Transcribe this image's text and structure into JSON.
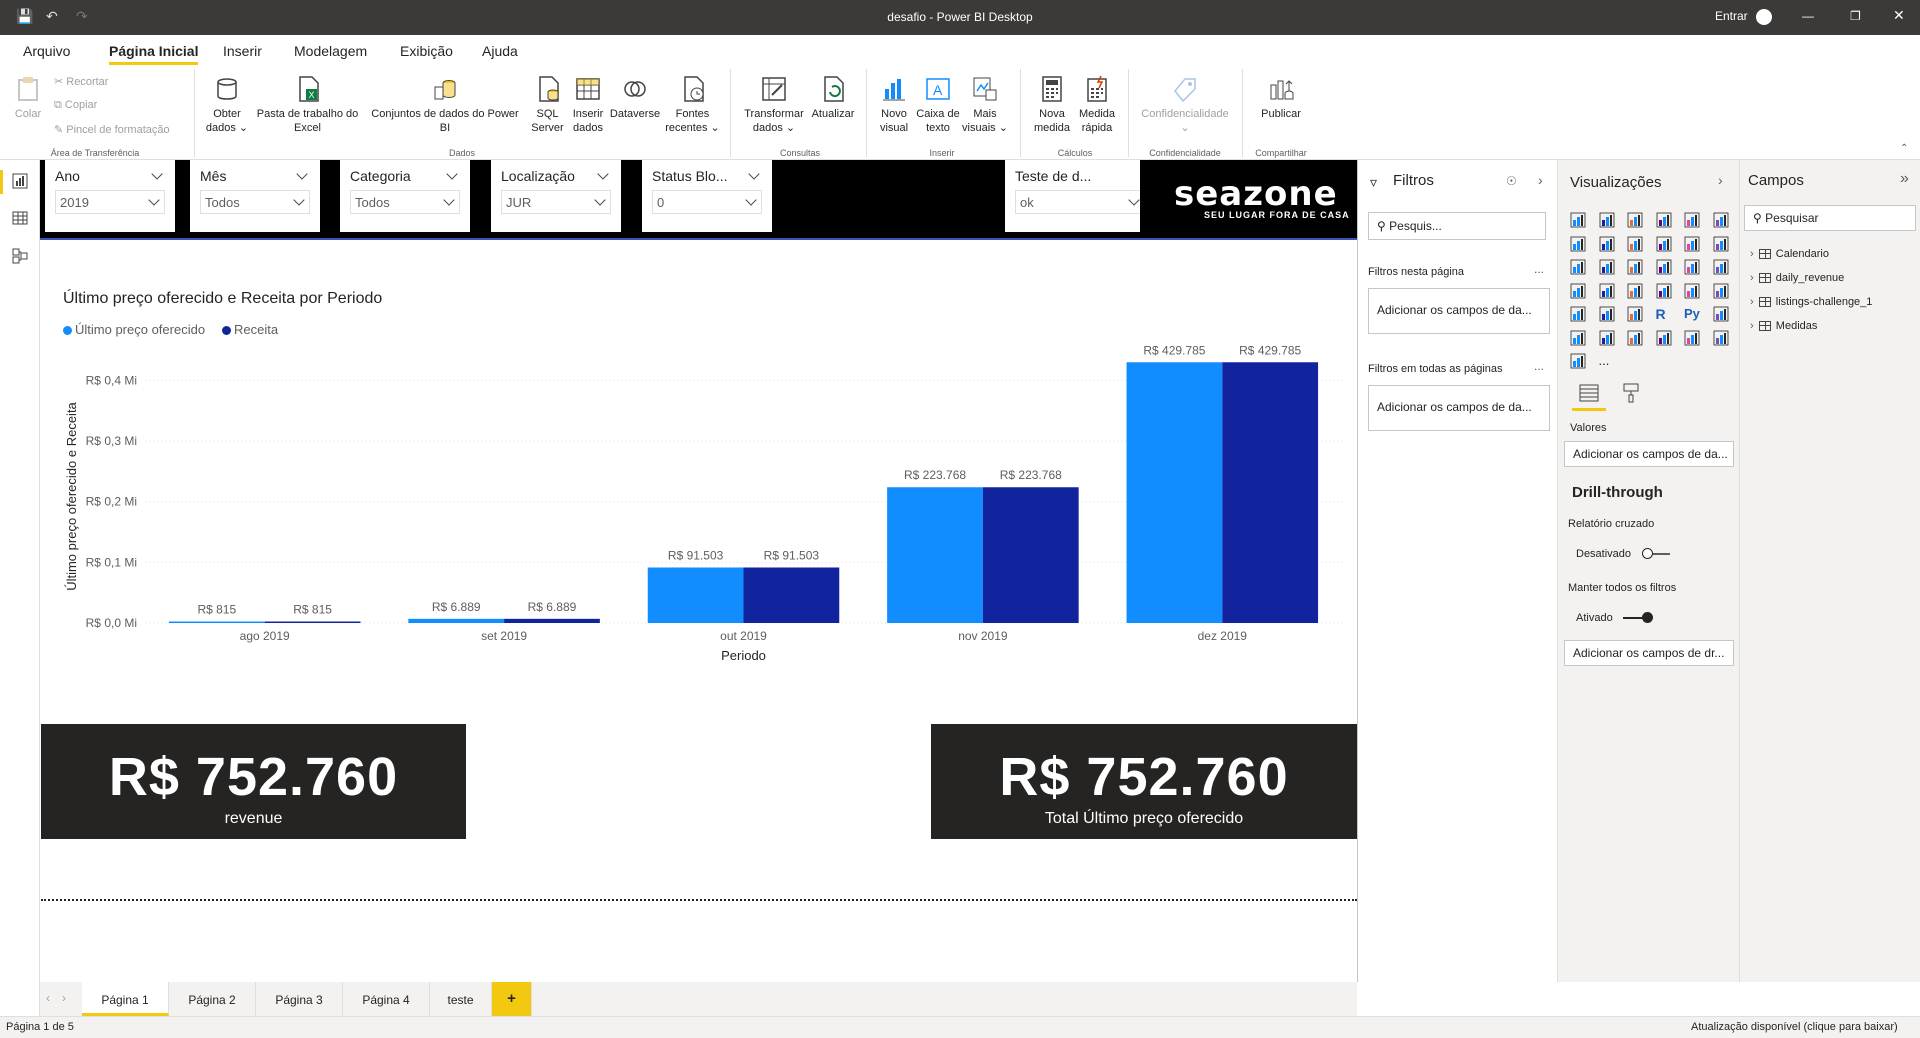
{
  "app": {
    "title": "desafio - Power BI Desktop",
    "signin": "Entrar"
  },
  "menu": [
    "Arquivo",
    "Página Inicial",
    "Inserir",
    "Modelagem",
    "Exibição",
    "Ajuda"
  ],
  "ribbon": {
    "clipboard": {
      "paste": "Colar",
      "cut": "Recortar",
      "copy": "Copiar",
      "format_painter": "Pincel de formatação",
      "group": "Área de Transferência"
    },
    "data": {
      "get_data": [
        "Obter",
        "dados ⌄"
      ],
      "excel": [
        "Pasta de trabalho do",
        "Excel"
      ],
      "datasets": [
        "Conjuntos de dados do Power",
        "BI"
      ],
      "sql": [
        "SQL",
        "Server"
      ],
      "enter_data": [
        "Inserir",
        "dados"
      ],
      "dataverse": [
        "Dataverse"
      ],
      "recent": [
        "Fontes",
        "recentes ⌄"
      ],
      "group": "Dados"
    },
    "queries": {
      "transform": [
        "Transformar",
        "dados ⌄"
      ],
      "refresh": [
        "Atualizar"
      ],
      "group": "Consultas"
    },
    "insert": {
      "new_visual": [
        "Novo",
        "visual"
      ],
      "text_box": [
        "Caixa de",
        "texto"
      ],
      "more_visuals": [
        "Mais",
        "visuais ⌄"
      ],
      "group": "Inserir"
    },
    "calculations": {
      "new_measure": [
        "Nova",
        "medida"
      ],
      "quick_measure": [
        "Medida",
        "rápida"
      ],
      "group": "Cálculos"
    },
    "sensitivity": {
      "label": [
        "Confidencialidade",
        "⌄"
      ],
      "group": "Confidencialidade"
    },
    "share": {
      "publish": [
        "Publicar"
      ],
      "group": "Compartilhar"
    }
  },
  "slicers": [
    {
      "label": "Ano",
      "value": "2019"
    },
    {
      "label": "Mês",
      "value": "Todos"
    },
    {
      "label": "Categoria",
      "value": "Todos"
    },
    {
      "label": "Localização",
      "value": "JUR"
    },
    {
      "label": "Status Blo...",
      "value": "0"
    },
    {
      "label": "Teste de d...",
      "value": "ok"
    }
  ],
  "logo": {
    "brand": "seazone",
    "tagline": "SEU LUGAR FORA DE CASA"
  },
  "chart_data": {
    "type": "bar",
    "title": "Último preço oferecido e Receita por Periodo",
    "xlabel": "Periodo",
    "ylabel": "Último preço oferecido e Receita",
    "categories": [
      "ago 2019",
      "set 2019",
      "out 2019",
      "nov 2019",
      "dez 2019"
    ],
    "series": [
      {
        "name": "Último preço oferecido",
        "color": "#118dff",
        "values": [
          815,
          6889,
          91503,
          223768,
          429785
        ],
        "labels": [
          "R$ 815",
          "R$ 6.889",
          "R$ 91.503",
          "R$ 223.768",
          "R$ 429.785"
        ]
      },
      {
        "name": "Receita",
        "color": "#12239e",
        "values": [
          815,
          6889,
          91503,
          223768,
          429785
        ],
        "labels": [
          "R$ 815",
          "R$ 6.889",
          "R$ 91.503",
          "R$ 223.768",
          "R$ 429.785"
        ]
      }
    ],
    "yticks": [
      0,
      100000,
      200000,
      300000,
      400000
    ],
    "ytick_labels": [
      "R$ 0,0 Mi",
      "R$ 0,1 Mi",
      "R$ 0,2 Mi",
      "R$ 0,3 Mi",
      "R$ 0,4 Mi"
    ],
    "ylim": [
      0,
      450000
    ],
    "legend": "top-left",
    "grid": true
  },
  "kpis": [
    {
      "value": "R$ 752.760",
      "label": "revenue"
    },
    {
      "value": "R$ 752.760",
      "label": "Total Último preço oferecido"
    }
  ],
  "filters": {
    "title": "Filtros",
    "search_placeholder": "Pesquis...",
    "page_filters": "Filtros nesta página",
    "all_pages_filters": "Filtros em todas as páginas",
    "add_fields": "Adicionar os campos de da...",
    "more": "..."
  },
  "visualizations": {
    "title": "Visualizações",
    "values_label": "Valores",
    "add_fields": "Adicionar os campos de da...",
    "drillthrough": "Drill-through",
    "cross_report": "Relatório cruzado",
    "cross_report_state": "Desativado",
    "keep_filters": "Manter todos os filtros",
    "keep_filters_state": "Ativado",
    "add_drill": "Adicionar os campos de dr...",
    "more": "...",
    "r_label": "R",
    "py_label": "Py"
  },
  "fields": {
    "title": "Campos",
    "search_placeholder": "Pesquisar",
    "tables": [
      "Calendario",
      "daily_revenue",
      "listings-challenge_1",
      "Medidas"
    ]
  },
  "tabs": [
    "Página 1",
    "Página 2",
    "Página 3",
    "Página 4",
    "teste"
  ],
  "add_tab": "+",
  "status": {
    "page": "Página 1 de 5",
    "update": "Atualização disponível (clique para baixar)"
  }
}
